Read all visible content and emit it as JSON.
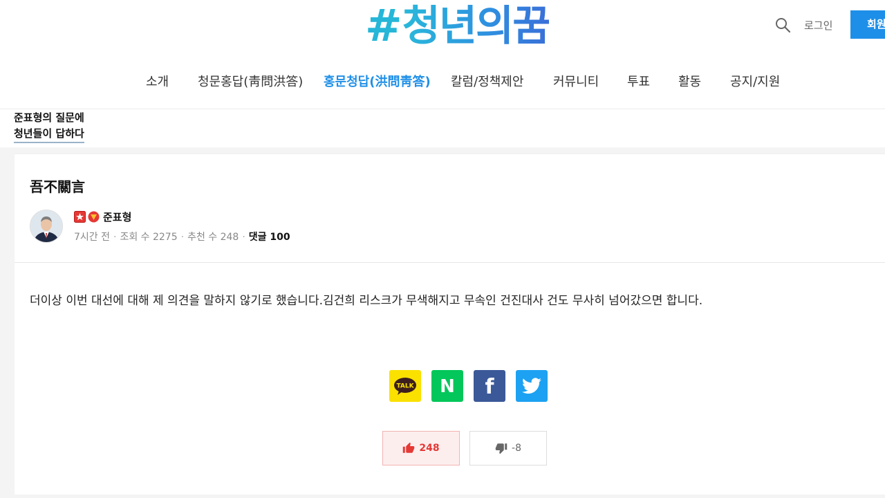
{
  "header": {
    "logo_hash": "#",
    "logo_text": "청년의꿈",
    "login_label": "로그인",
    "signup_label": "회원가입",
    "search_icon": "search-icon"
  },
  "nav": {
    "items": [
      {
        "label": "소개"
      },
      {
        "label": "청문홍답(靑問洪答)"
      },
      {
        "label": "홍문청답(洪問靑答)"
      },
      {
        "label": "칼럼/정책제안"
      },
      {
        "label": "커뮤니티"
      },
      {
        "label": "투표"
      },
      {
        "label": "활동"
      },
      {
        "label": "공지/지원"
      }
    ],
    "active_index": 2,
    "active_color": "#1e8fe8"
  },
  "board": {
    "title_line1": "준표형의 질문에",
    "title_line2": "청년들이 답하다"
  },
  "post": {
    "title": "吾不關言",
    "author": "준표형",
    "meta": {
      "time": "7시간 전",
      "views": "조회 수 2275",
      "recommends": "추천 수 248",
      "comments": "댓글 100"
    },
    "body": "더이상 이번 대선에 대해 제 의견을 말하지 않기로 했습니다.김건희 리스크가 무색해지고 무속인 건진대사 건도 무사히 넘어갔으면 합니다."
  },
  "share": {
    "kakao_label": "TALK",
    "naver_label": "N",
    "facebook_label": "f",
    "icons": [
      "kakaotalk-icon",
      "naver-icon",
      "facebook-icon",
      "twitter-icon"
    ]
  },
  "votes": {
    "up": "248",
    "down": "-8",
    "up_color": "#e53935"
  }
}
